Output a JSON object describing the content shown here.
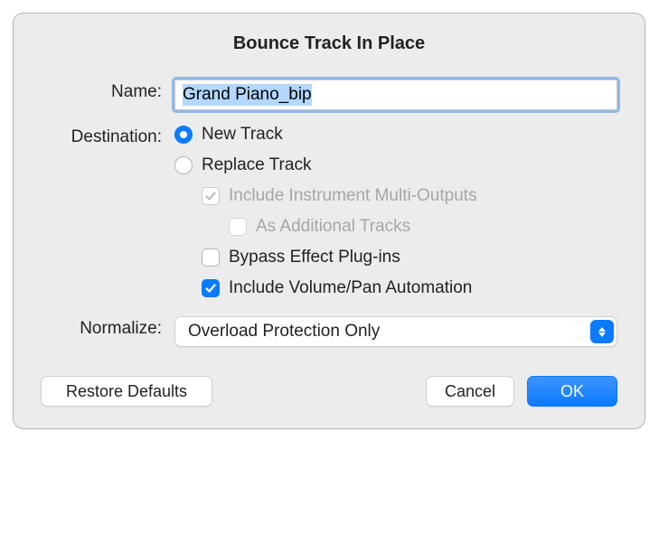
{
  "title": "Bounce Track In Place",
  "name": {
    "label": "Name:",
    "value": "Grand Piano_bip"
  },
  "destination": {
    "label": "Destination:",
    "options": {
      "new_track": "New Track",
      "replace_track": "Replace Track",
      "include_multi": "Include Instrument Multi-Outputs",
      "as_additional": "As Additional Tracks",
      "bypass_fx": "Bypass Effect Plug-ins",
      "include_volpan": "Include Volume/Pan Automation"
    }
  },
  "normalize": {
    "label": "Normalize:",
    "value": "Overload Protection Only"
  },
  "buttons": {
    "restore": "Restore Defaults",
    "cancel": "Cancel",
    "ok": "OK"
  }
}
